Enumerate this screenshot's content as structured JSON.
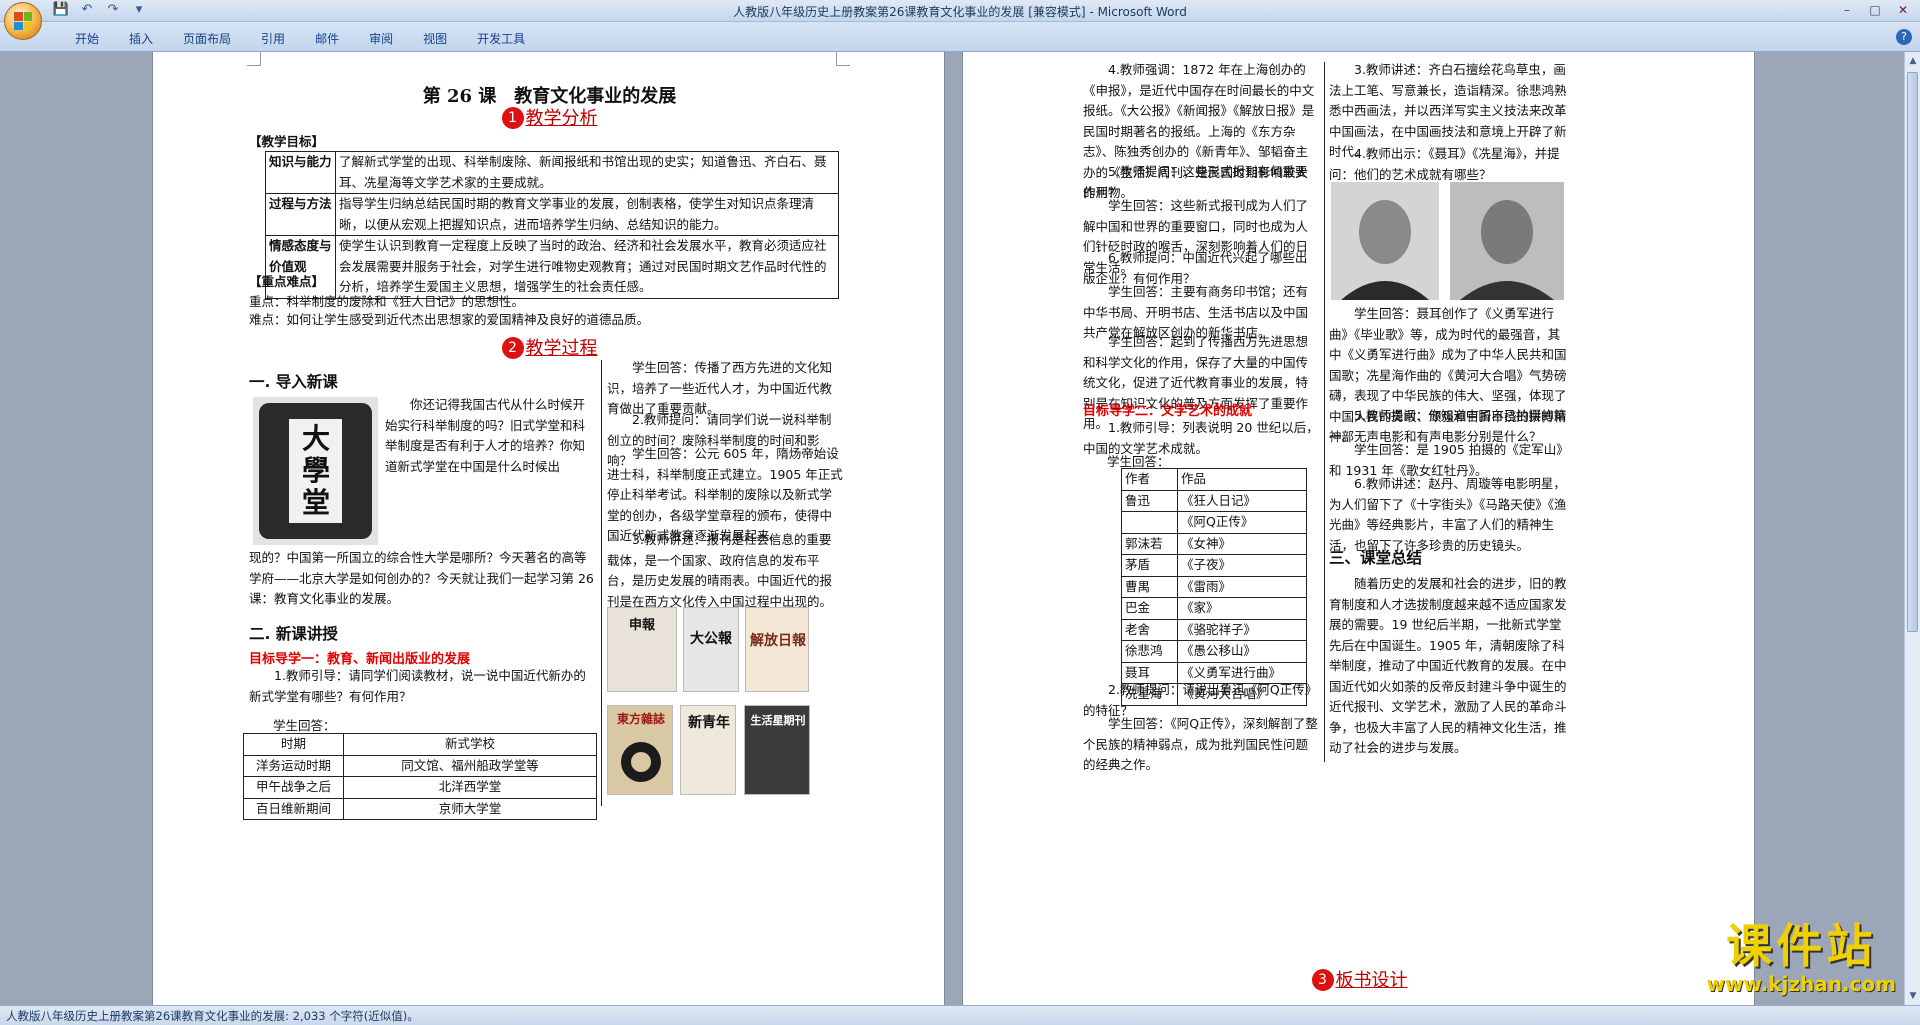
{
  "window": {
    "title": "人教版八年级历史上册教案第26课教育文化事业的发展 [兼容模式] - Microsoft Word",
    "controls": [
      "–",
      "□",
      "✕"
    ]
  },
  "qat": {
    "save": "💾",
    "undo": "↶",
    "redo": "↷",
    "more": "▾"
  },
  "ribbon": {
    "tabs": [
      "开始",
      "插入",
      "页面布局",
      "引用",
      "邮件",
      "审阅",
      "视图",
      "开发工具"
    ],
    "help": "?"
  },
  "status": "人教版八年级历史上册教案第26课教育文化事业的发展: 2,033 个字符(近似值)。",
  "watermark": {
    "big": "课件站",
    "small": "www.kjzhan.com"
  },
  "left": {
    "title": "第 26 课　教育文化事业的发展",
    "sec1": {
      "num": "1",
      "label": "教学分析"
    },
    "goals_head": "【教学目标】",
    "goals": [
      {
        "k": "知识与能力",
        "v": "了解新式学堂的出现、科举制废除、新闻报纸和书馆出现的史实；知道鲁迅、齐白石、聂耳、冼星海等文学艺术家的主要成就。"
      },
      {
        "k": "过程与方法",
        "v": "指导学生归纳总结民国时期的教育文学事业的发展，创制表格，使学生对知识点条理清晰，以便从宏观上把握知识点，进而培养学生归纳、总结知识的能力。"
      },
      {
        "k": "情感态度与价值观",
        "v": "使学生认识到教育一定程度上反映了当时的政治、经济和社会发展水平，教育必须适应社会发展需要并服务于社会，对学生进行唯物史观教育；通过对民国时期文艺作品时代性的分析，培养学生爱国主义思想，增强学生的社会责任感。"
      }
    ],
    "key_head": "【重点难点】",
    "key_point": "重点：科举制度的废除和《狂人日记》的思想性。",
    "difficult": "难点：如何让学生感受到近代杰出思想家的爱国精神及良好的道德品质。",
    "sec2": {
      "num": "2",
      "label": "教学过程"
    },
    "intro_head": "一. 导入新课",
    "plaque_text": "大學堂",
    "intro_side": "你还记得我国古代从什么时候开始实行科举制度的吗？旧式学堂和科举制度是否有利于人才的培养？你知道新式学堂在中国是什么时候出",
    "intro_rest": "现的？中国第一所国立的综合性大学是哪所？今天著名的高等学府——北京大学是如何创办的？今天就让我们一起学习第 26 课：教育文化事业的发展。",
    "new_head": "二. 新课讲授",
    "goal1_head": "目标导学一：教育、新闻出版业的发展",
    "t1": "1.教师引导：请同学们阅读教材，说一说中国近代新办的新式学堂有哪些？有何作用？",
    "t1_ans": "学生回答：",
    "schools": {
      "head": [
        "时期",
        "新式学校"
      ],
      "rows": [
        [
          "洋务运动时期",
          "同文馆、福州船政学堂等"
        ],
        [
          "甲午战争之后",
          "北洋西学堂"
        ],
        [
          "百日维新期间",
          "京师大学堂"
        ]
      ]
    },
    "col2_a": "学生回答：传播了西方先进的文化知识，培养了一些近代人才，为中国近代教育做出了重要贡献。",
    "col2_b": "2.教师提问：请同学们说一说科举制创立的时间？废除科举制度的时间和影响？",
    "col2_c": "学生回答：公元 605 年，隋炀帝始设进士科，科举制度正式建立。1905 年正式停止科举考试。科举制的废除以及新式学堂的创办，各级学堂章程的颁布，使得中国近代新式教育逐渐发展起来。",
    "col2_d": "3.教师讲述：报刊是社会信息的重要载体，是一个国家、政府信息的发布平台，是历史发展的晴雨表。中国近代的报刊是在西方文化传入中国过程中出现的。",
    "papers": [
      "申報",
      "大公報",
      "解放日報",
      "東方雜誌",
      "新青年",
      "生活星期刊"
    ]
  },
  "right": {
    "c1_a": "4.教师强调：1872 年在上海创办的《申报》，是近代中国存在时间最长的中文报纸。《大公报》《新闻报》《解放日报》是民国时期著名的报纸。上海的《东方杂志》、陈独秀创办的《新青年》、邹韬奋主办的《生活》周刊，是民国时期影响较大的刊物。",
    "c1_b": "5.教师提问：这些形式报刊有何重要作用？",
    "c1_c": "学生回答：这些新式报刊成为人们了解中国和世界的重要窗口，同时也成为人们针砭时政的喉舌，深刻影响着人们的日常生活。",
    "c1_d": "6.教师提问：中国近代兴起了哪些出版企业？有何作用？",
    "c1_e": "学生回答：主要有商务印书馆；还有中华书局、开明书店、生活书店以及中国共产党在解放区创办的新华书店。",
    "c1_f": "学生回答：起到了传播西方先进思想和科学文化的作用，保存了大量的中国传统文化，促进了近代教育事业的发展，特别是在知识文化的普及方面发挥了重要作用。",
    "goal2_head": "目标导学二：文学艺术的成就",
    "c1_g": "1.教师引导：列表说明 20 世纪以后，中国的文学艺术成就。",
    "c1_h": "学生回答：",
    "works": {
      "head": [
        "作者",
        "作品"
      ],
      "rows": [
        [
          "鲁迅",
          "《狂人日记》"
        ],
        [
          "",
          "《阿Q正传》"
        ],
        [
          "郭沫若",
          "《女神》"
        ],
        [
          "茅盾",
          "《子夜》"
        ],
        [
          "曹禺",
          "《雷雨》"
        ],
        [
          "巴金",
          "《家》"
        ],
        [
          "老舍",
          "《骆驼祥子》"
        ],
        [
          "徐悲鸿",
          "《愚公移山》"
        ],
        [
          "聂耳",
          "《义勇军进行曲》"
        ],
        [
          "冼星海",
          "《黄河大合唱》"
        ]
      ]
    },
    "c1_i": "2.教师提问：请说出鲁迅《阿Q正传》的特征？",
    "c1_j": "学生回答：《阿Q正传》，深刻解剖了整个民族的精神弱点，成为批判国民性问题的经典之作。",
    "c2_a": "3.教师讲述：齐白石擅绘花鸟草虫，画法上工笔、写意兼长，造诣精深。徐悲鸿熟悉中西画法，并以西洋写实主义技法来改革中国画法，在中国画技法和意境上开辟了新时代。",
    "c2_b": "4.教师出示：《聂耳》《冼星海》，并提问：他们的艺术成就有哪些？",
    "c2_c": "学生回答：聂耳创作了《义勇军进行曲》《毕业歌》等，成为时代的最强音，其中《义勇军进行曲》成为了中华人民共和国国歌；冼星海作曲的《黄河大合唱》气势磅礴，表现了中华民族的伟大、坚强，体现了中国人民的勇敢、顽强和百折不挠的拼搏精神。",
    "c2_d": "5.教师提问：你知道中国自己拍摄的第一部无声电影和有声电影分别是什么？",
    "c2_e": "学生回答：是 1905 拍摄的《定军山》和 1931 年《歌女红牡丹》。",
    "c2_f": "6.教师讲述：赵丹、周璇等电影明星，为人们留下了《十字街头》《马路天使》《渔光曲》等经典影片，丰富了人们的精神生活，也留下了许多珍贵的历史镜头。",
    "summary_head": "三、课堂总结",
    "c2_g": "随着历史的发展和社会的进步，旧的教育制度和人才选拔制度越来越不适应国家发展的需要。19 世纪后半期，一批新式学堂先后在中国诞生。1905 年，清朝废除了科举制度，推动了中国近代教育的发展。在中国近代如火如荼的反帝反封建斗争中诞生的近代报刊、文学艺术，激励了人民的革命斗争，也极大丰富了人民的精神文化生活，推动了社会的进步与发展。",
    "sec3": {
      "num": "3",
      "label": "板书设计"
    }
  }
}
